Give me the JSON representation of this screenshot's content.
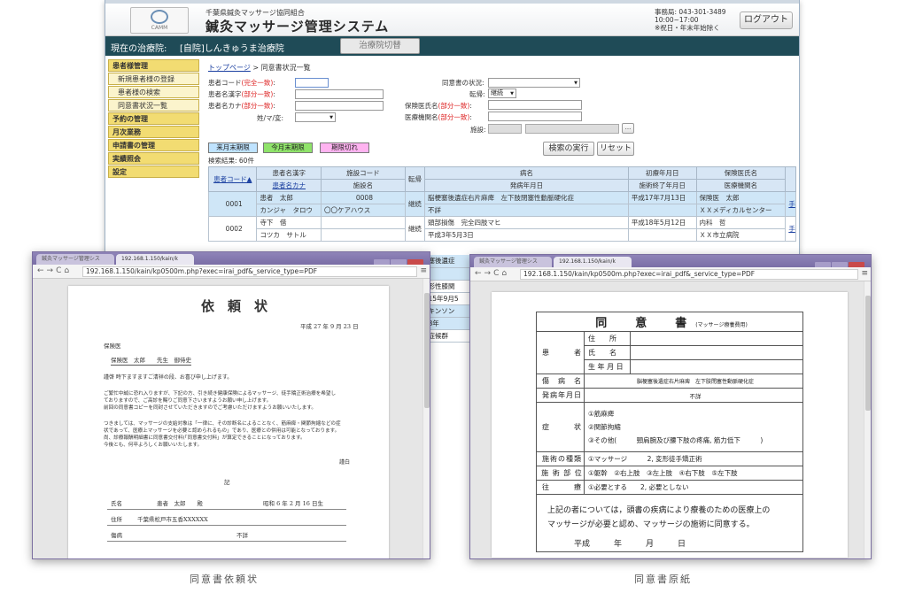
{
  "app": {
    "org": "千葉県鍼灸マッサージ協同組合",
    "system_name": "鍼灸マッサージ管理システム",
    "logo_text": "CAMM",
    "contact_lines": [
      "事務局: 043-301-3489",
      "10:00~17:00",
      "※祝日・年末年始除く"
    ],
    "logout": "ログアウト",
    "location_label": "現在の治療院:",
    "location_value": "[自院]しんきゅうま治療院",
    "switch_button": "治療院切替"
  },
  "sidebar": [
    {
      "label": "患者様管理",
      "type": "sec"
    },
    {
      "label": "新規患者様の登録",
      "type": "sub"
    },
    {
      "label": "患者様の検索",
      "type": "sub"
    },
    {
      "label": "同意書状況一覧",
      "type": "sub"
    },
    {
      "label": "予約の管理",
      "type": "sec"
    },
    {
      "label": "月次業務",
      "type": "sec"
    },
    {
      "label": "申請書の管理",
      "type": "sec"
    },
    {
      "label": "実績照会",
      "type": "sec"
    },
    {
      "label": "設定",
      "type": "sec"
    }
  ],
  "breadcrumb": {
    "top": "トップページ",
    "sep": " > ",
    "current": "同意書状況一覧"
  },
  "form": {
    "patient_code": "患者コード",
    "exact": "(完全一致)",
    "patient_kanji": "患者名漢字",
    "partial": "(部分一致)",
    "patient_kana": "患者名カナ",
    "gender_label": "姓/マ/変:",
    "consent_status": "同意書の状況:",
    "transfer": "転帰:",
    "transfer_value": "継続",
    "insurance_doctor": "保険医氏名",
    "medical_inst": "医療機関名",
    "facility": "施設:",
    "ellipsis": "..."
  },
  "tags": [
    "来月末期限",
    "今月末期限",
    "期限切れ"
  ],
  "tag_colors": [
    "#bfe3ff",
    "#8fe36a",
    "#ffb3f0"
  ],
  "search_button": "検索の実行",
  "reset_button": "リセット",
  "result_count": "検索結果: 60件",
  "table": {
    "headers_top": [
      "患者名漢字",
      "施設コード",
      "転帰",
      "病名",
      "初療年月日",
      "保険医氏名"
    ],
    "headers_bottom": [
      "患者名カナ",
      "施設名",
      "発病年月日",
      "施術終了年月日",
      "医療機関名"
    ],
    "code_header": "患者コード▲",
    "rows": [
      {
        "code": "0001",
        "kanji": "患者　太郎",
        "facility_code": "0008",
        "kana": "カンジャ　タロウ",
        "facility": "〇〇ケアハウス",
        "transfer": "継続",
        "disease": "脳梗塞後遺症右片麻痺　左下肢閉塞性動脈硬化症",
        "onset": "不詳",
        "first": "平成17年7月13日",
        "end": "",
        "doctor": "保険医　太郎",
        "inst": "ＸＸメディカルセンター",
        "link": "手"
      },
      {
        "code": "0002",
        "kanji": "寺下　借",
        "facility_code": "",
        "kana": "コツカ　サトル",
        "facility": "",
        "transfer": "継続",
        "disease": "頭部損傷　完全四肢マヒ",
        "onset": "平成3年5月3日",
        "first": "平成18年5月12日",
        "end": "",
        "doctor": "内科　哲",
        "inst": "ＸＸ市立病院",
        "link": "手"
      }
    ],
    "peek_rows": [
      "梗塞後遺症",
      "詳",
      "変形性膝関",
      "成15年9月5",
      "ーキンソン",
      "成8年",
      "用症候群",
      "詳"
    ]
  },
  "browser_left": {
    "tab1": "鍼灸マッサージ管理シス",
    "tab2": "192.168.1.150/kain/k",
    "url": "192.168.1.150/kain/kp0500m.php?exec=irai_pdf&_service_type=PDF"
  },
  "browser_right": {
    "tab1": "鍼灸マッサージ管理シス",
    "tab2": "192.168.1.150/kain/k",
    "url": "192.168.1.150/kain/kp0500m.php?exec=irai_pdf&_service_type=PDF"
  },
  "request_doc": {
    "title": "依　頼　状",
    "date": "平成 27 年 9 月 23 日",
    "to_label": "保険医",
    "to_name": "保険医　太郎　　先生　御侍史",
    "greeting": "謹啓 時下ますますご清祥の段、お喜び申し上げます。",
    "para1": [
      "ご繁忙中誠に恐れ入りますが、下記の方、引き続き健康保険によるマッサージ、徒手矯正術治療を希望し",
      "ておりますので、ご高診を賜りご同意下さいますようお願い申し上げます。",
      "前回の同意書コピーを同封させていただきますのでご考慮いただけますようお願いいたします。"
    ],
    "para2": [
      "つきましては、マッサージの支給対象は「一律に、その診断名によることなく、筋麻痺・関節拘縮などの症",
      "状であって、医療上マッサージを必要と認められるもの」であり、医療との併用は可能となっております。",
      "尚、診療報酬明細書に同意書交付料(「同意書交付料」が算定できることになっております。",
      "今後とも、何卒よろしくお願いいたします。"
    ],
    "closing": "謹白",
    "ki": "記",
    "name_label": "氏名",
    "name_value": "患者　太郎　　殿",
    "birth": "昭和 6 年 2 月 16 日生",
    "addr_label": "住所",
    "addr_value": "千葉県松戸市五香XXXXXX",
    "disease_label": "傷病",
    "disease_value": "不詳"
  },
  "consent_doc": {
    "title": "同　　意　　書",
    "subtitle": "(マッサージ療養費用)",
    "patient": "患　　　者",
    "address": "住　　所",
    "name": "氏　　名",
    "birthdate": "生 年 月 日",
    "disease_label": "傷　病　名",
    "disease_value": "脳梗塞後遺症右片麻痺　左下肢閉塞性動脈硬化症",
    "onset_label": "発病年月日",
    "onset_value": "不詳",
    "symptom_label": "症　　　状",
    "symptoms": [
      "①筋麻痺",
      "②関節拘縮",
      "③その他(　　　頸肩腕及び腰下肢の疼痛, 筋力低下　　　)"
    ],
    "type_label": "施術の種類",
    "type_value": "①マッサージ　　　2, 変形徒手矯正術",
    "part_label": "施 術 部 位",
    "part_value": "①躯幹　②右上肢　③左上肢　④右下肢　⑤左下肢",
    "visit_label": "往　　　療",
    "visit_value": "①必要とする　　2, 必要としない",
    "statement": [
      "上記の者については，頭書の疾病により療養のための医療上の",
      "マッサージが必要と認め、マッサージの施術に同意する。"
    ],
    "date_row": "平成　　　年　　　月　　　日"
  },
  "captions": [
    "同意書依頼状",
    "同意書原紙"
  ]
}
